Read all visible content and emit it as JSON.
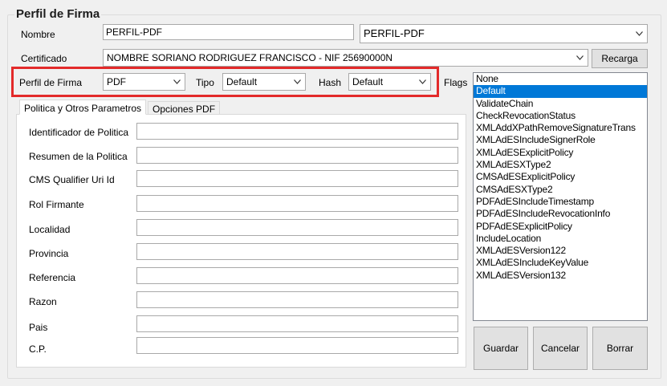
{
  "group": {
    "title": "Perfil de Firma"
  },
  "nombre": {
    "label": "Nombre",
    "value": "PERFIL-PDF",
    "combo": "PERFIL-PDF"
  },
  "certificado": {
    "label": "Certificado",
    "value": "NOMBRE SORIANO RODRIGUEZ FRANCISCO - NIF 25690000N",
    "button": "Recarga"
  },
  "perfil": {
    "label": "Perfil de Firma",
    "value": "PDF"
  },
  "tipo": {
    "label": "Tipo",
    "value": "Default"
  },
  "hash": {
    "label": "Hash",
    "value": "Default"
  },
  "flags": {
    "label": "Flags",
    "items": [
      "None",
      "Default",
      "ValidateChain",
      "CheckRevocationStatus",
      "XMLAddXPathRemoveSignatureTrans",
      "XMLAdESIncludeSignerRole",
      "XMLAdESExplicitPolicy",
      "XMLAdESXType2",
      "CMSAdESExplicitPolicy",
      "CMSAdESXType2",
      "PDFAdESIncludeTimestamp",
      "PDFAdESIncludeRevocationInfo",
      "PDFAdESExplicitPolicy",
      "IncludeLocation",
      "XMLAdESVersion122",
      "XMLAdESIncludeKeyValue",
      "XMLAdESVersion132"
    ],
    "selected": "Default"
  },
  "tabs": [
    "Politica y Otros Parametros",
    "Opciones PDF"
  ],
  "fields": [
    {
      "label": "Identificador de Politica",
      "value": ""
    },
    {
      "label": "Resumen de la Politica",
      "value": ""
    },
    {
      "label": "CMS Qualifier Uri Id",
      "value": ""
    },
    {
      "label": "Rol Firmante",
      "value": ""
    },
    {
      "label": "Localidad",
      "value": ""
    },
    {
      "label": "Provincia",
      "value": ""
    },
    {
      "label": "Referencia",
      "value": ""
    },
    {
      "label": "Razon",
      "value": ""
    },
    {
      "label": "Pais",
      "value": ""
    },
    {
      "label": "C.P.",
      "value": ""
    }
  ],
  "buttons": {
    "guardar": "Guardar",
    "cancelar": "Cancelar",
    "borrar": "Borrar"
  },
  "colors": {
    "highlight": "#e32a2a",
    "selection": "#0078d7"
  },
  "icons": {
    "dropdown": "chevron-down-icon"
  }
}
